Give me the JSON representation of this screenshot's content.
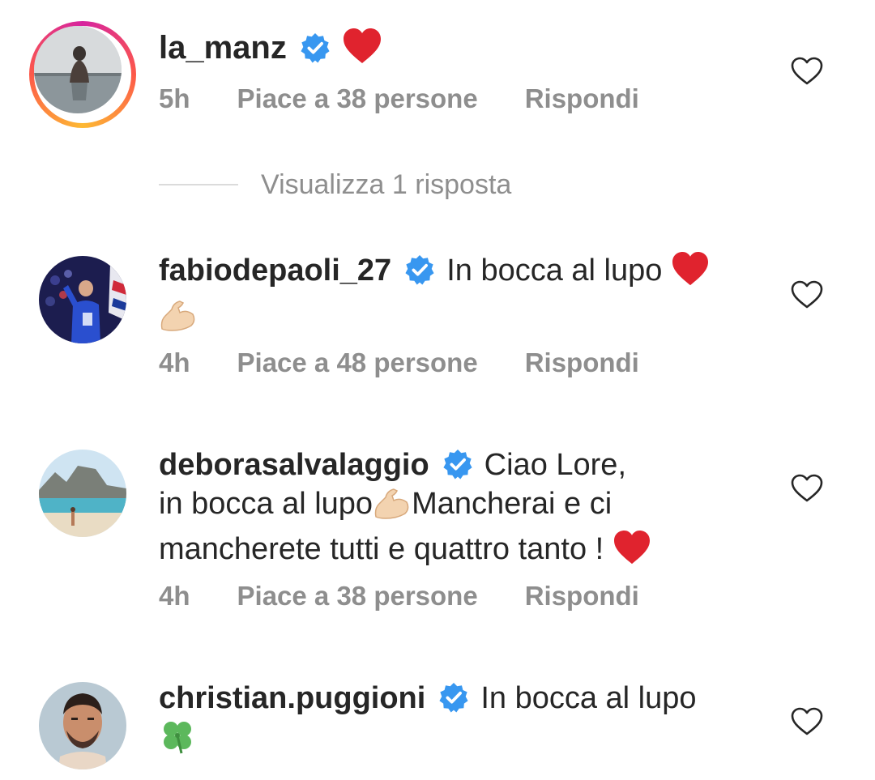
{
  "comments": [
    {
      "username": "la_manz",
      "text": "",
      "emojis": [
        "red-heart"
      ],
      "time": "5h",
      "likes": "Piace a 38 persone",
      "reply": "Rispondi",
      "replies_label": "Visualizza 1 risposta",
      "avatar": "woman-in-pool-photo"
    },
    {
      "username": "fabiodepaoli_27",
      "text": "In bocca al lupo",
      "emojis": [
        "red-heart",
        "flexed-biceps"
      ],
      "time": "4h",
      "likes": "Piace a 48 persone",
      "reply": "Rispondi",
      "avatar": "football-player-photo"
    },
    {
      "username": "deborasalvalaggio",
      "text_part1": "Ciao Lore,",
      "text_part2": "in bocca al lupo",
      "text_part3": "Mancherai e ci",
      "text_part4": "mancherete tutti e quattro tanto !",
      "emojis": [
        "flexed-biceps",
        "red-heart"
      ],
      "time": "4h",
      "likes": "Piace a 38 persone",
      "reply": "Rispondi",
      "avatar": "beach-photo"
    },
    {
      "username": "christian.puggioni",
      "text": "In bocca al lupo",
      "emojis": [
        "four-leaf-clover"
      ],
      "avatar": "man-portrait-photo"
    }
  ],
  "colors": {
    "verified": "#3897f0",
    "meta_text": "#8e8e8e",
    "heart_emoji": "#e0232e",
    "divider": "#dbdbdb"
  }
}
